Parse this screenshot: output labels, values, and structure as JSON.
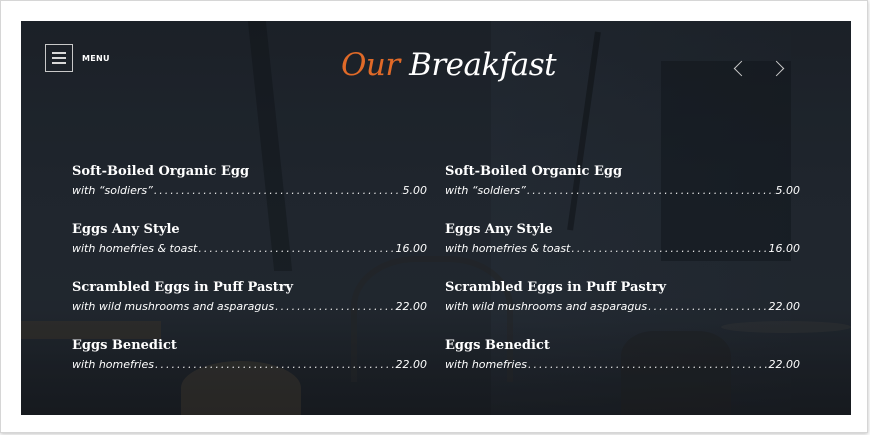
{
  "header": {
    "menu_label": "MENU",
    "title_accent": "Our",
    "title_main": "Breakfast"
  },
  "colors": {
    "accent": "#e06a28",
    "text": "#ffffff",
    "background": "#232a33"
  },
  "icons": {
    "menu": "hamburger-icon",
    "prev": "chevron-left-icon",
    "next": "chevron-right-icon"
  },
  "menu": {
    "left": [
      {
        "name": "Soft-Boiled Organic Egg",
        "desc": "with “soldiers”",
        "price": "5.00"
      },
      {
        "name": "Eggs Any Style",
        "desc": "with homefries & toast",
        "price": "16.00"
      },
      {
        "name": "Scrambled Eggs in Puff Pastry",
        "desc": "with wild mushrooms and asparagus",
        "price": "22.00"
      },
      {
        "name": "Eggs Benedict",
        "desc": "with homefries",
        "price": "22.00"
      }
    ],
    "right": [
      {
        "name": "Soft-Boiled Organic Egg",
        "desc": "with “soldiers”",
        "price": "5.00"
      },
      {
        "name": "Eggs Any Style",
        "desc": "with homefries & toast",
        "price": "16.00"
      },
      {
        "name": "Scrambled Eggs in Puff Pastry",
        "desc": "with wild mushrooms and asparagus",
        "price": "22.00"
      },
      {
        "name": "Eggs Benedict",
        "desc": "with homefries",
        "price": "22.00"
      }
    ]
  }
}
